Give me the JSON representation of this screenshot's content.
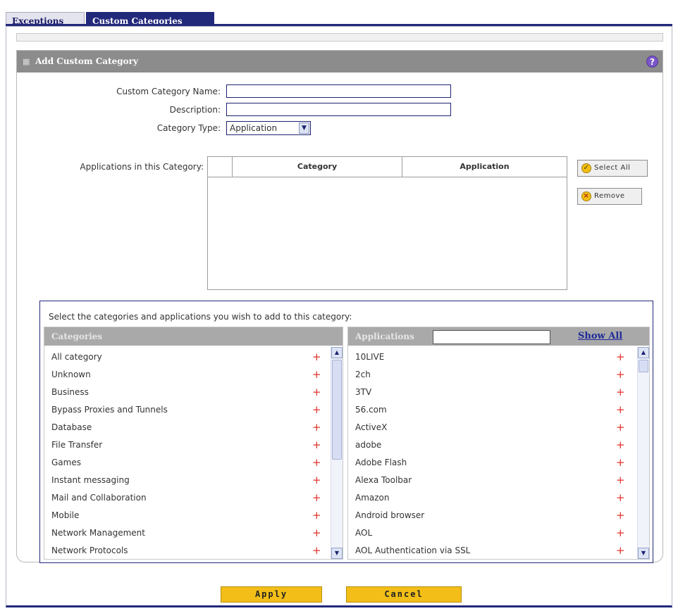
{
  "tabs": [
    {
      "label": "Exceptions",
      "active": false
    },
    {
      "label": "Custom Categories",
      "active": true
    }
  ],
  "section": {
    "title": "Add Custom Category",
    "help_icon": "?"
  },
  "form": {
    "name_label": "Custom Category Name:",
    "name_value": "",
    "description_label": "Description:",
    "description_value": "",
    "type_label": "Category Type:",
    "type_value": "Application",
    "apps_label": "Applications in this Category:"
  },
  "apps_table": {
    "columns": [
      "",
      "Category",
      "Application"
    ],
    "rows": []
  },
  "buttons": {
    "select_all": "Select All",
    "remove": "Remove",
    "apply": "Apply",
    "cancel": "Cancel"
  },
  "picker": {
    "prompt": "Select the categories and applications you wish to add to this category:",
    "categories_header": "Categories",
    "applications_header": "Applications",
    "search_value": "",
    "show_all": "Show All",
    "categories": [
      "All category",
      "Unknown",
      "Business",
      "Bypass Proxies and Tunnels",
      "Database",
      "File Transfer",
      "Games",
      "Instant messaging",
      "Mail and Collaboration",
      "Mobile",
      "Network Management",
      "Network Protocols"
    ],
    "applications": [
      "10LIVE",
      "2ch",
      "3TV",
      "56.com",
      "ActiveX",
      "adobe",
      "Adobe Flash",
      "Alexa Toolbar",
      "Amazon",
      "Android browser",
      "AOL",
      "AOL Authentication via SSL"
    ],
    "add_glyph": "+"
  },
  "colors": {
    "tab_active": "#22287a",
    "section_header": "#8c8c8c",
    "button_yellow": "#f2be17",
    "add_plus": "#e0302a",
    "link_blue": "#1f2a9a"
  }
}
